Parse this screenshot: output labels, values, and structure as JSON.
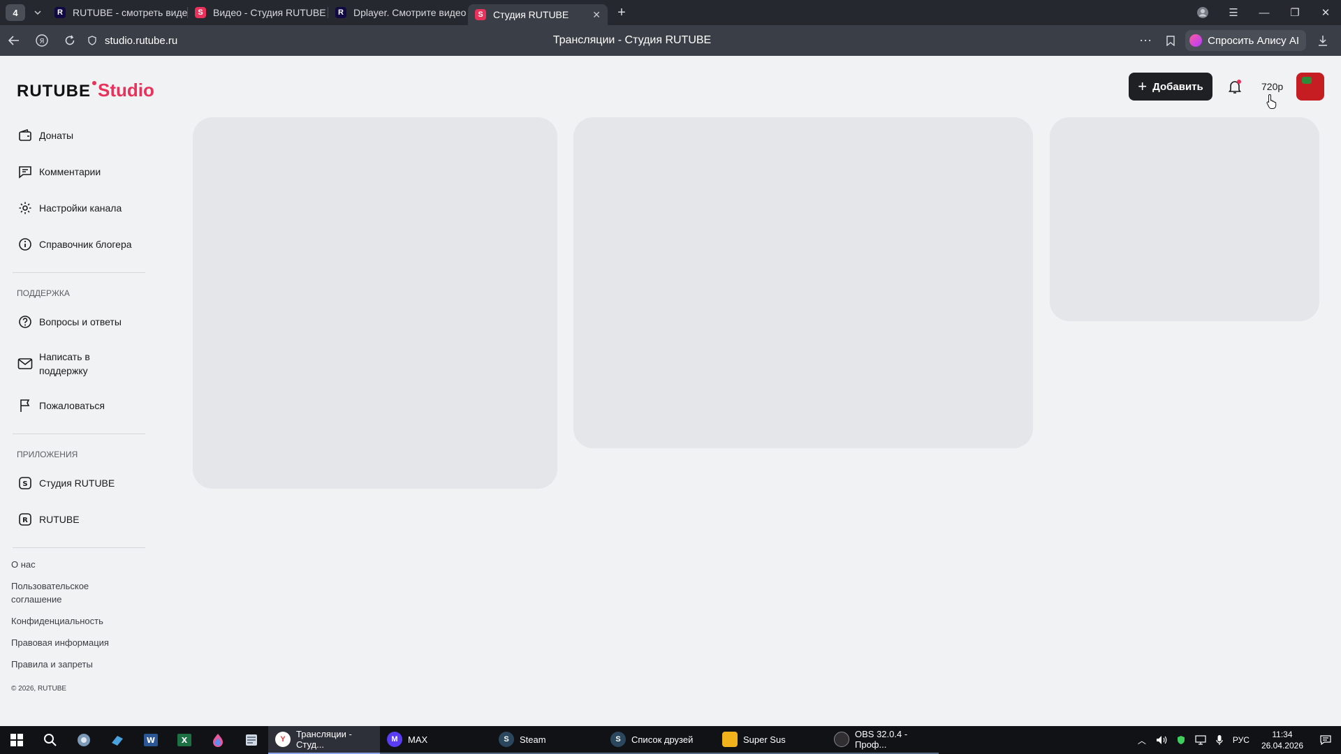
{
  "browser": {
    "tab_count": "4",
    "tabs": [
      {
        "label": "RUTUBE - смотреть виде",
        "favicon": "R"
      },
      {
        "label": "Видео - Студия RUTUBE",
        "favicon": "S"
      },
      {
        "label": "Dplayer. Смотрите видео",
        "favicon": "R"
      },
      {
        "label": "Студия RUTUBE",
        "favicon": "S",
        "active": true
      }
    ],
    "url": "studio.rutube.ru",
    "page_title": "Трансляции - Студия RUTUBE",
    "alice_label": "Спросить Алису AI"
  },
  "header": {
    "logo_main": "RUTUBE",
    "logo_sub": "Studio",
    "add_label": "Добавить",
    "quality": "720p"
  },
  "sidebar": {
    "main_items": [
      {
        "label": "Донаты",
        "icon": "wallet-icon"
      },
      {
        "label": "Комментарии",
        "icon": "comment-icon"
      },
      {
        "label": "Настройки канала",
        "icon": "gear-icon"
      },
      {
        "label": "Справочник блогера",
        "icon": "info-icon"
      }
    ],
    "support_title": "ПОДДЕРЖКА",
    "support_items": [
      {
        "label": "Вопросы и ответы",
        "icon": "question-icon"
      },
      {
        "label": "Написать в поддержку",
        "icon": "mail-icon"
      },
      {
        "label": "Пожаловаться",
        "icon": "flag-icon"
      }
    ],
    "apps_title": "ПРИЛОЖЕНИЯ",
    "apps_items": [
      {
        "label": "Студия RUTUBE",
        "icon": "studio-app-icon"
      },
      {
        "label": "RUTUBE",
        "icon": "rutube-app-icon"
      }
    ],
    "footer_links": [
      "О нас",
      "Пользовательское соглашение",
      "Конфиденциальность",
      "Правовая информация",
      "Правила и запреты"
    ],
    "copyright": "© 2026, RUTUBE"
  },
  "taskbar": {
    "apps": [
      {
        "label": "Трансляции - Студ...",
        "active": true,
        "color": "#ffffff"
      },
      {
        "label": "MAX",
        "color": "#5b3cf5"
      },
      {
        "label": "Steam",
        "color": "#1b2838"
      },
      {
        "label": "Список друзей",
        "color": "#1b2838"
      },
      {
        "label": "Super Sus",
        "color": "#f2b21b"
      },
      {
        "label": "OBS 32.0.4 - Проф...",
        "color": "#302e31"
      }
    ],
    "language": "РУС",
    "time": "11:34",
    "date": "26.04.2026"
  }
}
